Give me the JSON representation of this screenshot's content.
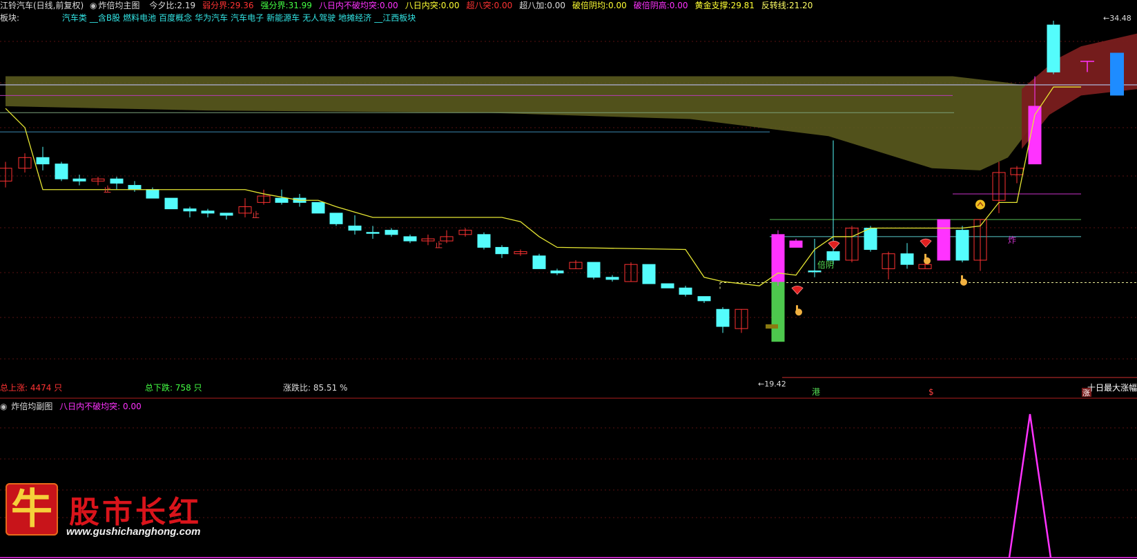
{
  "header": {
    "stock_title": "江铃汽车(日线,前复权)",
    "indicator_name": "炸倍均主图",
    "fields": [
      {
        "label": "今夕比:",
        "value": "2.19",
        "color": "#dddddd"
      },
      {
        "label": "弱分界:",
        "value": "29.36",
        "color": "#ff3333"
      },
      {
        "label": "强分界:",
        "value": "31.99",
        "color": "#44ff44"
      },
      {
        "label": "八日内不破均突:",
        "value": "0.00",
        "color": "#ff33ff"
      },
      {
        "label": "八日内突:",
        "value": "0.00",
        "color": "#ffff33"
      },
      {
        "label": "超八突:",
        "value": "0.00",
        "color": "#ff3333"
      },
      {
        "label": "超八加:",
        "value": "0.00",
        "color": "#dddddd"
      },
      {
        "label": "破倍阴均:",
        "value": "0.00",
        "color": "#ffff33"
      },
      {
        "label": "破倍阴高:",
        "value": "0.00",
        "color": "#ff33ff"
      },
      {
        "label": "黄金支撑:",
        "value": "29.81",
        "color": "#ffff33"
      },
      {
        "label": "反转线:",
        "value": "21.20",
        "color": "#ffff66"
      }
    ]
  },
  "sector": {
    "label": "板块:",
    "items": [
      "汽车类",
      "__含B股",
      "燃料电池",
      "百度概念",
      "华为汽车",
      "汽车电子",
      "新能源车",
      "无人驾驶",
      "地摊经济",
      "__江西板块"
    ]
  },
  "stats": {
    "up_label": "总上涨: 4474 只",
    "down_label": "总下跌: 758 只",
    "ratio_label": "涨跌比: 85.51 %"
  },
  "price_labels": {
    "high": "34.48",
    "low": "19.42"
  },
  "chart_texts": {
    "beiyin": "倍阴",
    "zha": "炸",
    "zhi": "止",
    "gang": "港",
    "dollar": "$",
    "zhang": "涨",
    "ten_day": "十日最大涨幅"
  },
  "sub_panel": {
    "name": "炸倍均副图",
    "field_label": "八日内不破均突:",
    "field_value": "0.00"
  },
  "logo": {
    "char": "牛",
    "title": "股市长红",
    "url": "www.gushichanghong.com"
  },
  "colors": {
    "up_candle": "#ff3232",
    "down_candle": "#54fcfc",
    "magenta": "#ff33ff",
    "green_candle": "#4dc84d",
    "blue_candle": "#1e8cff",
    "yellow_line": "#e6e633",
    "olive_band": "#5a5a1e",
    "red_band": "#7a1e1e"
  },
  "chart_data": {
    "type": "candlestick",
    "ylim": [
      18.9,
      35.2
    ],
    "candles": [
      [
        27.7,
        28.3,
        28.6,
        27.4,
        "u"
      ],
      [
        28.3,
        28.8,
        29.0,
        28.1,
        "u"
      ],
      [
        28.8,
        28.5,
        29.3,
        28.2,
        "d"
      ],
      [
        28.5,
        27.8,
        28.6,
        27.7,
        "d"
      ],
      [
        27.8,
        27.7,
        28.0,
        27.5,
        "d"
      ],
      [
        27.7,
        27.8,
        27.9,
        27.5,
        "u"
      ],
      [
        27.8,
        27.6,
        27.9,
        27.3,
        "d"
      ],
      [
        27.5,
        27.3,
        27.7,
        27.2,
        "d"
      ],
      [
        27.3,
        26.9,
        27.4,
        26.9,
        "d"
      ],
      [
        26.9,
        26.4,
        26.9,
        26.4,
        "d"
      ],
      [
        26.4,
        26.3,
        26.5,
        26.0,
        "d"
      ],
      [
        26.3,
        26.2,
        26.4,
        26.0,
        "d"
      ],
      [
        26.2,
        26.1,
        26.2,
        25.9,
        "d"
      ],
      [
        26.2,
        26.5,
        26.9,
        26.0,
        "u"
      ],
      [
        26.7,
        27.0,
        27.3,
        26.6,
        "u"
      ],
      [
        26.9,
        26.7,
        27.3,
        26.6,
        "d"
      ],
      [
        26.9,
        26.7,
        27.1,
        26.5,
        "d"
      ],
      [
        26.7,
        26.2,
        26.7,
        26.2,
        "d"
      ],
      [
        26.2,
        25.7,
        26.2,
        25.6,
        "d"
      ],
      [
        25.6,
        25.4,
        26.1,
        25.2,
        "d"
      ],
      [
        25.3,
        25.3,
        25.6,
        25.0,
        "d"
      ],
      [
        25.4,
        25.2,
        25.5,
        25.1,
        "d"
      ],
      [
        25.1,
        24.9,
        25.2,
        24.8,
        "d"
      ],
      [
        24.9,
        25.0,
        25.2,
        24.7,
        "u"
      ],
      [
        24.9,
        25.1,
        25.4,
        24.8,
        "u"
      ],
      [
        25.2,
        25.4,
        25.5,
        25.1,
        "u"
      ],
      [
        25.2,
        24.6,
        25.3,
        24.5,
        "d"
      ],
      [
        24.6,
        24.3,
        24.7,
        24.1,
        "d"
      ],
      [
        24.3,
        24.4,
        24.5,
        24.2,
        "u"
      ],
      [
        24.2,
        23.6,
        24.3,
        23.6,
        "d"
      ],
      [
        23.5,
        23.4,
        23.6,
        23.3,
        "d"
      ],
      [
        23.6,
        23.9,
        24.0,
        23.6,
        "u"
      ],
      [
        23.9,
        23.2,
        23.9,
        23.1,
        "d"
      ],
      [
        23.2,
        23.1,
        23.3,
        23.0,
        "d"
      ],
      [
        23.0,
        23.8,
        23.9,
        23.0,
        "u"
      ],
      [
        23.8,
        22.9,
        23.8,
        22.9,
        "d"
      ],
      [
        22.9,
        22.7,
        22.9,
        22.7,
        "d"
      ],
      [
        22.7,
        22.4,
        22.8,
        22.3,
        "d"
      ],
      [
        22.3,
        22.1,
        22.3,
        22.0,
        "d"
      ],
      [
        21.7,
        20.9,
        21.8,
        20.6,
        "d"
      ],
      [
        20.8,
        21.7,
        21.7,
        20.6,
        "u"
      ],
      [
        20.2,
        24.0,
        24.0,
        20.2,
        "g"
      ],
      [
        24.6,
        24.9,
        25.0,
        24.6,
        "m"
      ],
      [
        25.2,
        23.0,
        25.4,
        22.8,
        "m"
      ],
      [
        23.5,
        23.5,
        25.0,
        23.2,
        "d"
      ],
      [
        24.4,
        24.0,
        29.6,
        23.8,
        "d"
      ],
      [
        24.0,
        25.5,
        25.6,
        23.9,
        "u"
      ],
      [
        25.5,
        24.5,
        25.6,
        24.4,
        "d"
      ],
      [
        23.6,
        24.3,
        24.4,
        23.1,
        "u"
      ],
      [
        24.3,
        23.8,
        24.8,
        23.6,
        "d"
      ],
      [
        23.6,
        23.8,
        24.3,
        23.6,
        "u"
      ],
      [
        24.0,
        25.9,
        25.9,
        24.0,
        "m"
      ],
      [
        25.4,
        24.0,
        25.6,
        23.9,
        "d"
      ],
      [
        24.0,
        25.9,
        25.9,
        23.5,
        "u"
      ],
      [
        26.8,
        28.1,
        28.6,
        26.2,
        "u"
      ],
      [
        28.0,
        28.3,
        28.4,
        27.6,
        "u"
      ],
      [
        28.5,
        31.2,
        32.6,
        28.5,
        "m"
      ],
      [
        32.8,
        35.0,
        35.2,
        32.7,
        "d"
      ]
    ],
    "xs": [
      8,
      36,
      62,
      89,
      115,
      142,
      169,
      195,
      221,
      248,
      275,
      301,
      328,
      355,
      382,
      408,
      434,
      461,
      487,
      514,
      540,
      567,
      594,
      620,
      647,
      674,
      701,
      727,
      754,
      781,
      807,
      834,
      860,
      887,
      914,
      940,
      967,
      993,
      1020,
      1047,
      1074,
      1127,
      1153,
      1127,
      1180,
      1207,
      1234,
      1261,
      1287,
      1314,
      1340,
      1367,
      1394,
      1420,
      1447,
      1473,
      1499,
      1526
    ],
    "series": [
      {
        "points": [
          [
            8,
            31.1
          ],
          [
            36,
            30.2
          ],
          [
            62,
            27.3
          ],
          [
            355,
            27.3
          ],
          [
            382,
            27.1
          ],
          [
            434,
            26.8
          ],
          [
            461,
            26.8
          ],
          [
            487,
            26.5
          ],
          [
            540,
            26.0
          ],
          [
            727,
            26.0
          ],
          [
            754,
            25.8
          ],
          [
            781,
            25.1
          ],
          [
            807,
            24.6
          ],
          [
            993,
            24.5
          ],
          [
            1020,
            23.2
          ],
          [
            1047,
            23.0
          ],
          [
            1074,
            22.9
          ],
          [
            1100,
            22.8
          ],
          [
            1127,
            23.4
          ],
          [
            1153,
            23.3
          ],
          [
            1180,
            24.5
          ],
          [
            1207,
            25.1
          ],
          [
            1234,
            25.1
          ],
          [
            1261,
            25.5
          ],
          [
            1287,
            25.5
          ],
          [
            1314,
            25.5
          ],
          [
            1340,
            25.5
          ],
          [
            1367,
            25.5
          ],
          [
            1394,
            25.5
          ],
          [
            1420,
            25.6
          ],
          [
            1447,
            26.7
          ],
          [
            1473,
            26.7
          ],
          [
            1499,
            30.8
          ],
          [
            1526,
            32.1
          ],
          [
            1566,
            32.1
          ]
        ]
      }
    ],
    "markers": {
      "hearts": [
        [
          1155,
          22.6
        ],
        [
          1208,
          24.7
        ],
        [
          1341,
          24.8
        ]
      ],
      "hands": [
        [
          1155,
          21.7
        ],
        [
          1341,
          24.1
        ],
        [
          1394,
          23.1
        ]
      ],
      "face": [
        1420,
        26.6
      ],
      "zhi": [
        [
          150,
          27.2
        ],
        [
          365,
          26.0
        ],
        [
          630,
          24.6
        ]
      ],
      "dashed_support": 22.95,
      "ref_lines": [
        [
          0,
          1647,
          32.2,
          "#a8a8c8",
          1.3
        ],
        [
          0,
          1380,
          31.7,
          "#b83cb8",
          1
        ],
        [
          0,
          1382,
          30.9,
          "#7aa07a",
          1
        ],
        [
          0,
          1115,
          30.0,
          "#3c8cb4",
          1
        ],
        [
          1380,
          1566,
          27.1,
          "#cc33cc",
          1
        ],
        [
          1115,
          1566,
          25.9,
          "#55bb55",
          1
        ],
        [
          1115,
          1566,
          25.1,
          "#5acdcd",
          1
        ]
      ]
    }
  }
}
